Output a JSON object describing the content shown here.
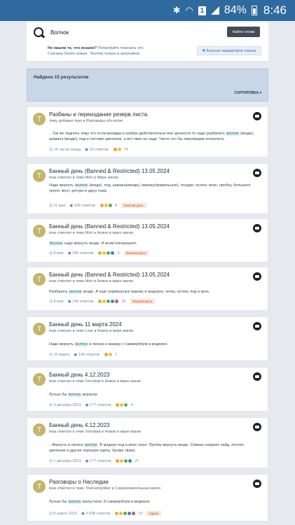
{
  "status": {
    "battery": "84%",
    "time": "8:46",
    "sim": "1"
  },
  "search": {
    "query": "Волчок",
    "button": "Найти снова"
  },
  "suggestion": {
    "prefix": "Не нашли то, что искали?",
    "text": "Попробуйте поискать это:",
    "link1": "Сначала более новые",
    "link2": "Волчок только в заголовках"
  },
  "more_params": "Больше параметров поиска",
  "results": {
    "title": "Найдено 15 результатов",
    "sort": "СОРТИРОВКА"
  },
  "colors": {
    "highlight_bg": "#dff1e3",
    "link": "#2e6fb0",
    "avatar": "#c4b56a",
    "tag_bg": "#fbe3d7"
  },
  "cards": [
    {
      "avatar": "T",
      "title": "Разбаны и переиздание резерв листа.",
      "sub": "тему добавил teas в Разговоры обо всём",
      "body_pre": "...Так же поднять тему что если визарда и азабро действительно вне ценности то надо разбанить ",
      "body_hl": "волчок",
      "body_post": " (везде), шамана (везде), под и летчике цветение, а вот твин не надо. Чисто что бы твиноводов потролить.",
      "time": "14 часов назад",
      "replies": "18 ответов",
      "rcount": "74",
      "tag": ""
    },
    {
      "avatar": "T",
      "title": "Банный день (Banned & Restricted) 13.05.2024",
      "sub": "teas ответил в теме Mori в Мире магии",
      "body_pre": "Надо вернуть ",
      "body_hl": "волчок",
      "body_post": " (везде), под, шамана(везде), макаку(правильную), пондер, путинг, мокс, пробку, большого троля, мост, ретурн и джуз тьма.",
      "time": "11 мая",
      "replies": "196 ответов",
      "rcount": "8",
      "tag": "Банный день"
    },
    {
      "avatar": "T",
      "title": "Банный день (Banned & Restricted) 13.05.2024",
      "sub": "teas ответил в теме Mori в Новое в мире магии",
      "body_pre": "",
      "body_hl": "Волчок",
      "body_post": " надо вернуть везде. И всем покорошеет.",
      "time": "8 мая",
      "replies": "196 ответов",
      "rcount": "5",
      "tag": "Банный день"
    },
    {
      "avatar": "T",
      "title": "Банный день (Banned & Restricted) 13.05.2024",
      "sub": "teas ответил в теме Mori в Новое в мире магии",
      "body_pre": "Разбанить ",
      "body_hl": "волчок",
      "body_post": " везде. А ещё нормальную макаку в модерне, печку, путинг, под и мокс.",
      "time": "8 мая",
      "replies": "196 ответов",
      "rcount": "20",
      "tag": "Банный день"
    },
    {
      "avatar": "T",
      "title": "Банный день 11 марта 2024",
      "sub": "teas ответил в теме Lear в Новое в мире магии",
      "body_pre": "Надо вернуть ",
      "body_hl": "волчок",
      "body_post": " в легаси и макаку с саммерблум в модерне.",
      "time": "10 марта",
      "replies": "148 ответов",
      "rcount": "7",
      "tag": ""
    },
    {
      "avatar": "T",
      "title": "Банный день 4.12.2023",
      "sub": "teas ответил в теме Xenobait в Новое в мире магии",
      "body_pre": "Лучше бы ",
      "body_hl": "волчок",
      "body_post": " вернули.",
      "time": "4 декабря 2023",
      "replies": "177 ответов",
      "rcount": "4",
      "tag": ""
    },
    {
      "avatar": "T",
      "title": "Банный день 4.12.2023",
      "sub": "teas ответил в теме Xenobait в Новое в мире магии",
      "body_pre": "...Вернуть в легаси ",
      "body_hl": "волчок",
      "body_post": ". В модерн под и мокс опал. Пробку вернуть везде. Симкан опирает пайд, летнее цветение и другие хорошие карты. Кроме твика.",
      "time": "1 декабря 2023",
      "replies": "177 ответов",
      "rcount": "27",
      "tag": ""
    },
    {
      "avatar": "T",
      "title": "Разговоры о Наследии",
      "sub": "teas ответил в теме TheFamilyMan в Соревновательная магия",
      "body_pre": "Лучше бы ",
      "body_hl": "волчок",
      "body_post": " выпустили. И саммерблум в модерне.",
      "time": "8 марта 2023",
      "replies": "2 638 ответов",
      "rcount": "15",
      "tag": "legacy"
    }
  ]
}
